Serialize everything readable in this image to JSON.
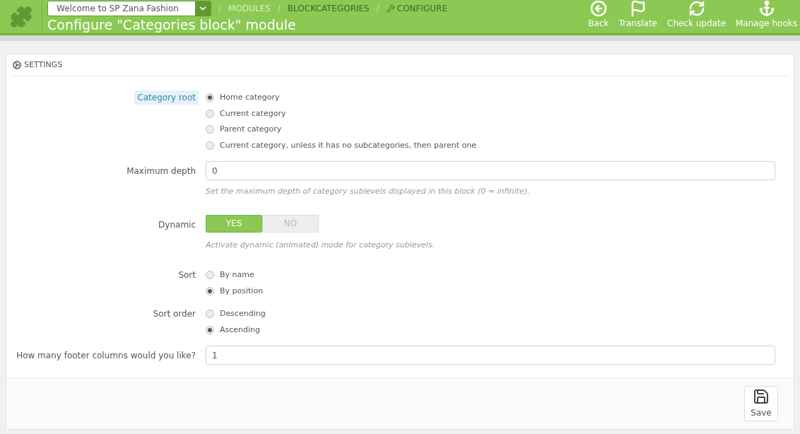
{
  "header": {
    "shop_select": "Welcome to SP Zana Fashion",
    "breadcrumb": [
      {
        "separator": "/",
        "label": "MODULES"
      },
      {
        "separator": "/",
        "label": "BLOCKCATEGORIES"
      },
      {
        "separator": "/",
        "label": "CONFIGURE"
      }
    ],
    "title": "Configure \"Categories block\" module",
    "toolbar": [
      {
        "label": "Back"
      },
      {
        "label": "Translate"
      },
      {
        "label": "Check update"
      },
      {
        "label": "Manage hooks"
      }
    ]
  },
  "panel": {
    "heading": "SETTINGS",
    "fields": [
      {
        "kind": "radio",
        "label": "Category root",
        "hint": true,
        "options": [
          {
            "label": "Home category",
            "selected": true
          },
          {
            "label": "Current category",
            "selected": false
          },
          {
            "label": "Parent category",
            "selected": false
          },
          {
            "label": "Current category, unless it has no subcategories, then parent one",
            "selected": false
          }
        ]
      },
      {
        "kind": "text",
        "label": "Maximum depth",
        "hint": false,
        "value": "0",
        "help": "Set the maximum depth of category sublevels displayed in this block (0 = infinite)."
      },
      {
        "kind": "switch",
        "label": "Dynamic",
        "hint": false,
        "options": [
          {
            "label": "YES",
            "selected": true
          },
          {
            "label": "NO",
            "selected": false
          }
        ],
        "help": "Activate dynamic (animated) mode for category sublevels."
      },
      {
        "kind": "radio",
        "label": "Sort",
        "hint": false,
        "options": [
          {
            "label": "By name",
            "selected": false
          },
          {
            "label": "By position",
            "selected": true
          }
        ]
      },
      {
        "kind": "radio",
        "label": "Sort order",
        "hint": false,
        "options": [
          {
            "label": "Descending",
            "selected": false
          },
          {
            "label": "Ascending",
            "selected": true
          }
        ]
      },
      {
        "kind": "text",
        "label": "How many footer columns would you like?",
        "hint": false,
        "value": "1"
      }
    ],
    "save": "Save"
  }
}
